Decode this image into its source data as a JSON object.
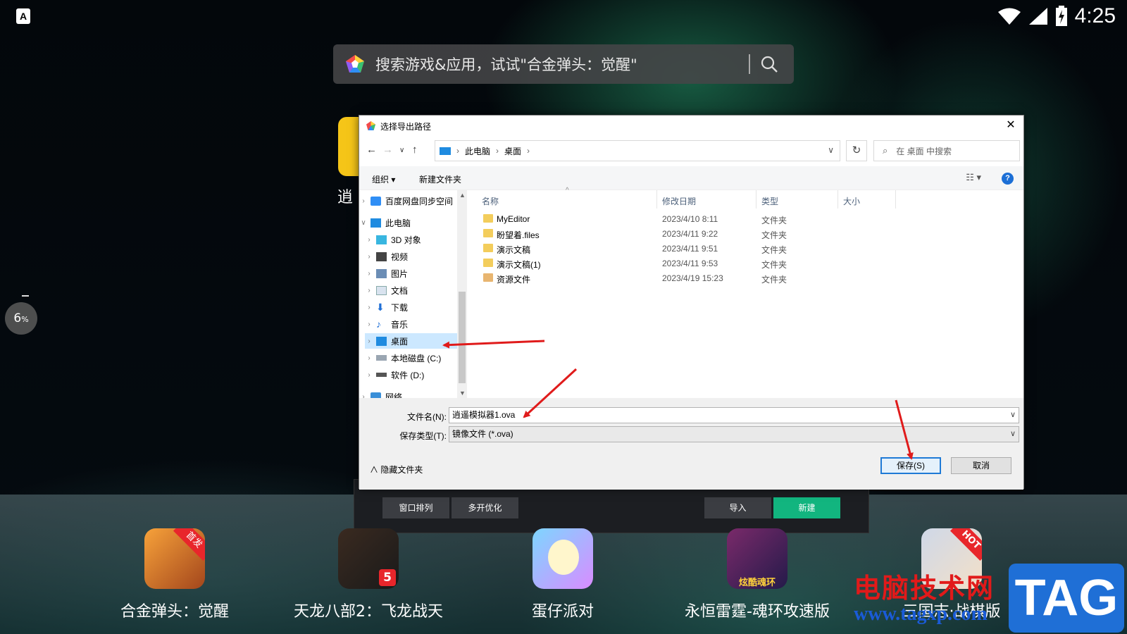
{
  "status_bar": {
    "time": "4:25",
    "wifi_icon": "wifi-icon",
    "signal_icon": "signal-icon",
    "battery_icon": "battery-charging-icon",
    "keyboard_badge": "A"
  },
  "search": {
    "placeholder": "搜索游戏&应用，试试\"合金弹头：觉醒\""
  },
  "left": {
    "yellow_app_label": "逍",
    "perf_value": "6",
    "perf_unit": "%"
  },
  "manager": {
    "buttons": [
      "窗口排列",
      "多开优化",
      "导入",
      "新建"
    ],
    "accent": "#12b57f"
  },
  "dock": {
    "apps": [
      {
        "label": "合金弹头：觉醒",
        "badge": "首发"
      },
      {
        "label": "天龙八部2：飞龙战天",
        "badge": "5"
      },
      {
        "label": "蛋仔派对",
        "badge": ""
      },
      {
        "label": "永恒雷霆-魂环攻速版",
        "badge": "炫酷魂环"
      },
      {
        "label": "三国志·战棋版",
        "badge": "HOT"
      }
    ]
  },
  "watermark": {
    "line1": "电脑技术网",
    "line2": "www.tagxp.com",
    "tag": "TAG"
  },
  "dialog": {
    "title": "选择导出路径",
    "address": {
      "root": "此电脑",
      "current": "桌面"
    },
    "search_placeholder": "在 桌面 中搜索",
    "toolbar": {
      "organize": "组织 ▾",
      "new_folder": "新建文件夹"
    },
    "tree": [
      {
        "label": "百度网盘同步空间",
        "icon": "baidu-icon"
      },
      {
        "label": "此电脑",
        "icon": "pc-icon"
      },
      {
        "label": "3D 对象",
        "icon": "cube-icon"
      },
      {
        "label": "视频",
        "icon": "video-icon"
      },
      {
        "label": "图片",
        "icon": "pictures-icon"
      },
      {
        "label": "文档",
        "icon": "documents-icon"
      },
      {
        "label": "下载",
        "icon": "download-icon"
      },
      {
        "label": "音乐",
        "icon": "music-icon"
      },
      {
        "label": "桌面",
        "icon": "desktop-icon",
        "selected": true
      },
      {
        "label": "本地磁盘 (C:)",
        "icon": "disk-icon"
      },
      {
        "label": "软件 (D:)",
        "icon": "disk-icon"
      },
      {
        "label": "网络",
        "icon": "network-icon"
      }
    ],
    "columns": [
      "名称",
      "修改日期",
      "类型",
      "大小"
    ],
    "files": [
      {
        "name": "MyEditor",
        "date": "2023/4/10 8:11",
        "type": "文件夹"
      },
      {
        "name": "盼望着.files",
        "date": "2023/4/11 9:22",
        "type": "文件夹"
      },
      {
        "name": "演示文稿",
        "date": "2023/4/11 9:51",
        "type": "文件夹"
      },
      {
        "name": "演示文稿(1)",
        "date": "2023/4/11 9:53",
        "type": "文件夹"
      },
      {
        "name": "资源文件",
        "date": "2023/4/19 15:23",
        "type": "文件夹"
      }
    ],
    "filename_label": "文件名(N):",
    "filename_value": "逍遥模拟器1.ova",
    "filetype_label": "保存类型(T):",
    "filetype_value": "镜像文件 (*.ova)",
    "hide_folders": "隐藏文件夹",
    "save_label": "保存(S)",
    "cancel_label": "取消"
  }
}
